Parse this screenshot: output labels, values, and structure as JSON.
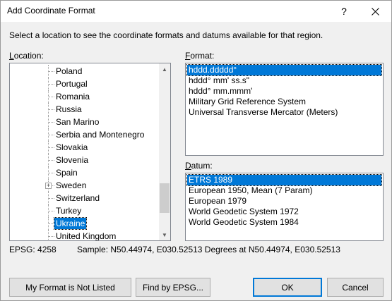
{
  "window": {
    "title": "Add Coordinate Format",
    "help_label": "?"
  },
  "instruction": "Select a location to see the coordinate formats and datums available for that region.",
  "location": {
    "label_accel": "L",
    "label_rest": "ocation:",
    "items": [
      {
        "label": "Poland"
      },
      {
        "label": "Portugal"
      },
      {
        "label": "Romania"
      },
      {
        "label": "Russia"
      },
      {
        "label": "San Marino"
      },
      {
        "label": "Serbia and Montenegro"
      },
      {
        "label": "Slovakia"
      },
      {
        "label": "Slovenia"
      },
      {
        "label": "Spain"
      },
      {
        "label": "Sweden",
        "expandable": true
      },
      {
        "label": "Switzerland"
      },
      {
        "label": "Turkey"
      },
      {
        "label": "Ukraine",
        "selected": true
      },
      {
        "label": "United Kingdom"
      }
    ]
  },
  "format": {
    "label_accel": "F",
    "label_rest": "ormat:",
    "items": [
      "hddd.ddddd°",
      "hddd° mm' ss.s\"",
      "hddd° mm.mmm'",
      "Military Grid Reference System",
      "Universal Transverse Mercator (Meters)"
    ],
    "selected_index": 0
  },
  "datum": {
    "label_accel": "D",
    "label_rest": "atum:",
    "items": [
      "ETRS 1989",
      "European 1950, Mean (7 Param)",
      "European 1979",
      "World Geodetic System 1972",
      "World Geodetic System 1984"
    ],
    "selected_index": 0
  },
  "status": {
    "epsg": "EPSG: 4258",
    "sample": "Sample: N50.44974, E030.52513 Degrees at N50.44974, E030.52513"
  },
  "buttons": {
    "not_listed": "My Format is Not Listed",
    "find_epsg": "Find by EPSG...",
    "ok": "OK",
    "cancel": "Cancel"
  },
  "colors": {
    "selection": "#0078d7",
    "dialog_bg": "#f0f0f0"
  }
}
